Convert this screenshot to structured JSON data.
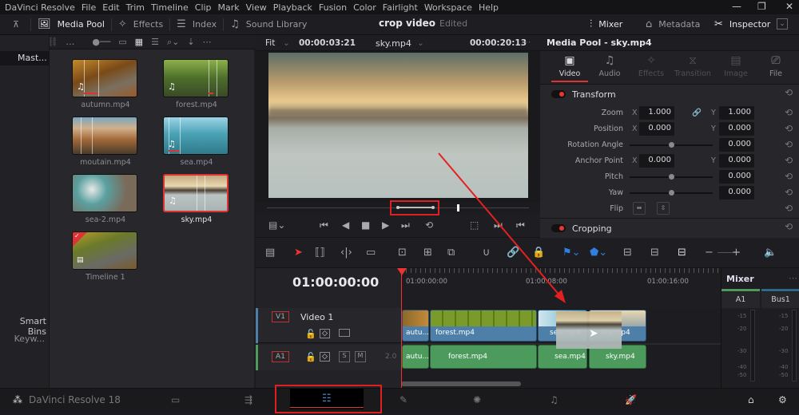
{
  "menubar": {
    "app": "DaVinci Resolve",
    "items": [
      "File",
      "Edit",
      "Trim",
      "Timeline",
      "Clip",
      "Mark",
      "View",
      "Playback",
      "Fusion",
      "Color",
      "Fairlight",
      "Workspace",
      "Help"
    ],
    "window_controls": {
      "minimize": "—",
      "restore": "❐",
      "close": "✕"
    }
  },
  "toolbar": {
    "media_pool": "Media Pool",
    "effects": "Effects",
    "index": "Index",
    "sound_library": "Sound Library",
    "project_title": "crop video",
    "project_status": "Edited",
    "mixer": "Mixer",
    "metadata": "Metadata",
    "inspector": "Inspector"
  },
  "bins": {
    "master": "Mast...",
    "smart_bins": "Smart Bins",
    "keywords": "Keyw..."
  },
  "media_pool": {
    "clips": [
      {
        "name": "autumn.mp4",
        "audio": true,
        "selected": false
      },
      {
        "name": "forest.mp4",
        "audio": true,
        "selected": false
      },
      {
        "name": "moutain.mp4",
        "audio": false,
        "selected": false
      },
      {
        "name": "sea.mp4",
        "audio": true,
        "selected": false
      },
      {
        "name": "sea-2.mp4",
        "audio": false,
        "selected": false
      },
      {
        "name": "sky.mp4",
        "audio": true,
        "selected": true
      },
      {
        "name": "Timeline 1",
        "audio": false,
        "selected": false,
        "timeline": true
      }
    ]
  },
  "viewer": {
    "zoom": "Fit",
    "source_timecode": "00:00:03:21",
    "clip_name": "sky.mp4",
    "duration_timecode": "00:00:20:13"
  },
  "inspector": {
    "title": "Media Pool - sky.mp4",
    "tabs": [
      {
        "label": "Video",
        "state": "active"
      },
      {
        "label": "Audio",
        "state": "enabled"
      },
      {
        "label": "Effects",
        "state": "disabled"
      },
      {
        "label": "Transition",
        "state": "disabled"
      },
      {
        "label": "Image",
        "state": "disabled"
      },
      {
        "label": "File",
        "state": "enabled"
      }
    ],
    "transform": {
      "title": "Transform",
      "zoom": {
        "label": "Zoom",
        "x": "1.000",
        "y": "1.000"
      },
      "position": {
        "label": "Position",
        "x": "0.000",
        "y": "0.000"
      },
      "rotation": {
        "label": "Rotation Angle",
        "value": "0.000"
      },
      "anchor": {
        "label": "Anchor Point",
        "x": "0.000",
        "y": "0.000"
      },
      "pitch": {
        "label": "Pitch",
        "value": "0.000"
      },
      "yaw": {
        "label": "Yaw",
        "value": "0.000"
      },
      "flip": {
        "label": "Flip"
      }
    },
    "cropping": {
      "title": "Cropping"
    }
  },
  "timeline": {
    "current_timecode": "01:00:00:00",
    "ruler_labels": [
      "01:00:00:00",
      "01:00:08:00",
      "01:00:16:00"
    ],
    "video_track": {
      "id": "V1",
      "name": "Video 1"
    },
    "audio_track": {
      "id": "A1",
      "level": "2.0",
      "solo": "S",
      "mute": "M"
    },
    "video_clips": [
      "autu...",
      "forest.mp4",
      "sea.mp4",
      "sky.mp4"
    ],
    "audio_clips": [
      "autu...",
      "forest.mp4",
      "sea.mp4",
      "sky.mp4"
    ]
  },
  "mixer": {
    "title": "Mixer",
    "channels": [
      "A1",
      "Bus1"
    ],
    "db_scale": [
      "-15",
      "-20",
      "-30",
      "-40",
      "-50"
    ]
  },
  "bottombar": {
    "brand": "DaVinci Resolve 18",
    "active_page": "edit"
  },
  "colors": {
    "accent_red": "#e02020",
    "video_clip": "#4e7fa8",
    "audio_clip": "#4c9b5d"
  }
}
